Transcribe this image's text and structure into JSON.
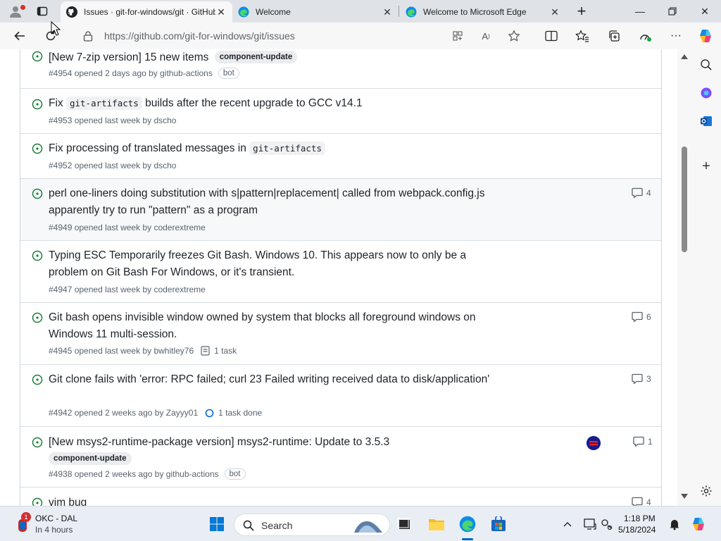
{
  "tabs": [
    {
      "title": "Issues · git-for-windows/git · GitHub",
      "favicon": "github-icon",
      "active": true
    },
    {
      "title": "Welcome",
      "favicon": "edge-icon",
      "active": false
    },
    {
      "title": "Welcome to Microsoft Edge",
      "favicon": "edge-icon",
      "active": false
    }
  ],
  "address": {
    "url": "https://github.com/git-for-windows/git/issues"
  },
  "issues": [
    {
      "title_parts": [
        {
          "t": "[New 7-zip version] 15 new items"
        }
      ],
      "labels": [
        "component-update"
      ],
      "meta": "#4954 opened 2 days ago by github-actions",
      "bot": "bot",
      "comments": null
    },
    {
      "title_parts": [
        {
          "t": "Fix "
        },
        {
          "code": "git-artifacts"
        },
        {
          "t": " builds after the recent upgrade to GCC v14.1"
        }
      ],
      "meta": "#4953 opened last week by dscho",
      "comments": null
    },
    {
      "title_parts": [
        {
          "t": "Fix processing of translated messages in "
        },
        {
          "code": "git-artifacts"
        }
      ],
      "meta": "#4952 opened last week by dscho",
      "comments": null
    },
    {
      "title_parts": [
        {
          "t": "perl one-liners doing substitution with s|pattern|replacement| called from webpack.config.js apparently try to run \"pattern\" as a program"
        }
      ],
      "meta": "#4949 opened last week by coderextreme",
      "comments": "4"
    },
    {
      "title_parts": [
        {
          "t": "Typing ESC Temporarily freezes Git Bash. Windows 10. This appears now to only be a problem on Git Bash For Windows, or it's transient."
        }
      ],
      "meta": "#4947 opened last week by coderextreme",
      "comments": null
    },
    {
      "title_parts": [
        {
          "t": "Git bash opens invisible window owned by system that blocks all foreground windows on Windows 11 multi-session."
        }
      ],
      "meta": "#4945 opened last week by bwhitley76",
      "task": "1 task",
      "comments": "6"
    },
    {
      "title_parts": [
        {
          "t": "Git clone fails with 'error: RPC failed; curl 23 Failed writing received data to disk/application'"
        }
      ],
      "meta": "#4942 opened 2 weeks ago by Zayyy01",
      "task_done": "1 task done",
      "comments": "3"
    },
    {
      "title_parts": [
        {
          "t": "[New msys2-runtime-package version] msys2-runtime: Update to 3.5.3"
        }
      ],
      "labels_below": [
        "component-update"
      ],
      "meta": "#4938 opened 2 weeks ago by github-actions",
      "bot": "bot",
      "comments": "1",
      "avatar": true
    },
    {
      "title_parts": [
        {
          "t": "vim bug"
        }
      ],
      "meta": "",
      "comments": "4"
    }
  ],
  "taskbar": {
    "weather_title": "OKC - DAL",
    "weather_sub": "In 4 hours",
    "weather_badge": "1",
    "search_placeholder": "Search",
    "time": "1:18 PM",
    "date": "5/18/2024"
  },
  "colors": {
    "open_issue": "#1a7f37",
    "edge_blue": "#0c8ce9"
  }
}
